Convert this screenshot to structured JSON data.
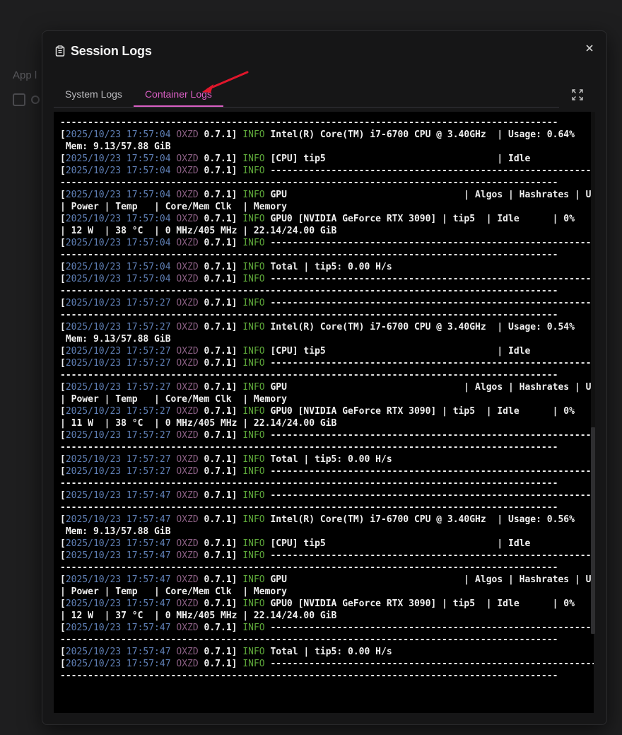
{
  "background": {
    "app_label": "App l"
  },
  "modal": {
    "title": "Session Logs",
    "title_icon": "clipboard-icon",
    "close_icon": "close-icon",
    "expand_icon": "expand-icon"
  },
  "tabs": [
    {
      "label": "System Logs",
      "active": false
    },
    {
      "label": "Container Logs",
      "active": true
    }
  ],
  "colors": {
    "accent": "#d95fc4",
    "timestamp": "#5f7fb5",
    "source": "#8a5f83",
    "level_info": "#5ea83a",
    "annotation_arrow": "#e0162b"
  },
  "log": {
    "lines": [
      {
        "text": "------------------------------------------------------------------------------------------"
      },
      {
        "ts": "2025/10/23 17:57:04",
        "src": "OXZD",
        "ver": "0.7.1]",
        "lvl": "INFO",
        "msg": "Intel(R) Core(TM) i7-6700 CPU @ 3.40GHz  | Usage: 0.64%   |"
      },
      {
        "text": " Mem: 9.13/57.88 GiB"
      },
      {
        "ts": "2025/10/23 17:57:04",
        "src": "OXZD",
        "ver": "0.7.1]",
        "lvl": "INFO",
        "msg": "[CPU] tip5                               | Idle"
      },
      {
        "ts": "2025/10/23 17:57:04",
        "src": "OXZD",
        "ver": "0.7.1]",
        "lvl": "INFO",
        "msg": "-----------------------------------------------------------"
      },
      {
        "text": "------------------------------------------------------------------------------------------"
      },
      {
        "ts": "2025/10/23 17:57:04",
        "src": "OXZD",
        "ver": "0.7.1]",
        "lvl": "INFO",
        "msg": "GPU                                | Algos | Hashrates | Usage"
      },
      {
        "text": "| Power | Temp   | Core/Mem Clk  | Memory"
      },
      {
        "ts": "2025/10/23 17:57:04",
        "src": "OXZD",
        "ver": "0.7.1]",
        "lvl": "INFO",
        "msg": "GPU0 [NVIDIA GeForce RTX 3090] | tip5  | Idle      | 0%"
      },
      {
        "text": "| 12 W  | 38 °C  | 0 MHz/405 MHz | 22.14/24.00 GiB"
      },
      {
        "ts": "2025/10/23 17:57:04",
        "src": "OXZD",
        "ver": "0.7.1]",
        "lvl": "INFO",
        "msg": "-----------------------------------------------------------"
      },
      {
        "text": "------------------------------------------------------------------------------------------"
      },
      {
        "ts": "2025/10/23 17:57:04",
        "src": "OXZD",
        "ver": "0.7.1]",
        "lvl": "INFO",
        "msg": "Total | tip5: 0.00 H/s"
      },
      {
        "ts": "2025/10/23 17:57:04",
        "src": "OXZD",
        "ver": "0.7.1]",
        "lvl": "INFO",
        "msg": "-----------------------------------------------------------"
      },
      {
        "text": "------------------------------------------------------------------------------------------"
      },
      {
        "ts": "2025/10/23 17:57:27",
        "src": "OXZD",
        "ver": "0.7.1]",
        "lvl": "INFO",
        "msg": "-----------------------------------------------------------"
      },
      {
        "text": "------------------------------------------------------------------------------------------"
      },
      {
        "ts": "2025/10/23 17:57:27",
        "src": "OXZD",
        "ver": "0.7.1]",
        "lvl": "INFO",
        "msg": "Intel(R) Core(TM) i7-6700 CPU @ 3.40GHz  | Usage: 0.54%   |"
      },
      {
        "text": " Mem: 9.13/57.88 GiB"
      },
      {
        "ts": "2025/10/23 17:57:27",
        "src": "OXZD",
        "ver": "0.7.1]",
        "lvl": "INFO",
        "msg": "[CPU] tip5                               | Idle"
      },
      {
        "ts": "2025/10/23 17:57:27",
        "src": "OXZD",
        "ver": "0.7.1]",
        "lvl": "INFO",
        "msg": "-----------------------------------------------------------"
      },
      {
        "text": "------------------------------------------------------------------------------------------"
      },
      {
        "ts": "2025/10/23 17:57:27",
        "src": "OXZD",
        "ver": "0.7.1]",
        "lvl": "INFO",
        "msg": "GPU                                | Algos | Hashrates | Usage"
      },
      {
        "text": "| Power | Temp   | Core/Mem Clk  | Memory"
      },
      {
        "ts": "2025/10/23 17:57:27",
        "src": "OXZD",
        "ver": "0.7.1]",
        "lvl": "INFO",
        "msg": "GPU0 [NVIDIA GeForce RTX 3090] | tip5  | Idle      | 0%"
      },
      {
        "text": "| 11 W  | 38 °C  | 0 MHz/405 MHz | 22.14/24.00 GiB"
      },
      {
        "ts": "2025/10/23 17:57:27",
        "src": "OXZD",
        "ver": "0.7.1]",
        "lvl": "INFO",
        "msg": "-----------------------------------------------------------"
      },
      {
        "text": "------------------------------------------------------------------------------------------"
      },
      {
        "ts": "2025/10/23 17:57:27",
        "src": "OXZD",
        "ver": "0.7.1]",
        "lvl": "INFO",
        "msg": "Total | tip5: 0.00 H/s"
      },
      {
        "ts": "2025/10/23 17:57:27",
        "src": "OXZD",
        "ver": "0.7.1]",
        "lvl": "INFO",
        "msg": "-----------------------------------------------------------"
      },
      {
        "text": "------------------------------------------------------------------------------------------"
      },
      {
        "ts": "2025/10/23 17:57:47",
        "src": "OXZD",
        "ver": "0.7.1]",
        "lvl": "INFO",
        "msg": "-----------------------------------------------------------"
      },
      {
        "text": "------------------------------------------------------------------------------------------"
      },
      {
        "ts": "2025/10/23 17:57:47",
        "src": "OXZD",
        "ver": "0.7.1]",
        "lvl": "INFO",
        "msg": "Intel(R) Core(TM) i7-6700 CPU @ 3.40GHz  | Usage: 0.56%   |"
      },
      {
        "text": " Mem: 9.13/57.88 GiB"
      },
      {
        "ts": "2025/10/23 17:57:47",
        "src": "OXZD",
        "ver": "0.7.1]",
        "lvl": "INFO",
        "msg": "[CPU] tip5                               | Idle"
      },
      {
        "ts": "2025/10/23 17:57:47",
        "src": "OXZD",
        "ver": "0.7.1]",
        "lvl": "INFO",
        "msg": "-----------------------------------------------------------"
      },
      {
        "text": "------------------------------------------------------------------------------------------"
      },
      {
        "ts": "2025/10/23 17:57:47",
        "src": "OXZD",
        "ver": "0.7.1]",
        "lvl": "INFO",
        "msg": "GPU                                | Algos | Hashrates | Usage"
      },
      {
        "text": "| Power | Temp   | Core/Mem Clk  | Memory"
      },
      {
        "ts": "2025/10/23 17:57:47",
        "src": "OXZD",
        "ver": "0.7.1]",
        "lvl": "INFO",
        "msg": "GPU0 [NVIDIA GeForce RTX 3090] | tip5  | Idle      | 0%"
      },
      {
        "text": "| 12 W  | 37 °C  | 0 MHz/405 MHz | 22.14/24.00 GiB"
      },
      {
        "ts": "2025/10/23 17:57:47",
        "src": "OXZD",
        "ver": "0.7.1]",
        "lvl": "INFO",
        "msg": "-----------------------------------------------------------"
      },
      {
        "text": "------------------------------------------------------------------------------------------"
      },
      {
        "ts": "2025/10/23 17:57:47",
        "src": "OXZD",
        "ver": "0.7.1]",
        "lvl": "INFO",
        "msg": "Total | tip5: 0.00 H/s"
      },
      {
        "ts": "2025/10/23 17:57:47",
        "src": "OXZD",
        "ver": "0.7.1]",
        "lvl": "INFO",
        "msg": "-----------------------------------------------------------"
      },
      {
        "text": "------------------------------------------------------------------------------------------"
      }
    ]
  }
}
